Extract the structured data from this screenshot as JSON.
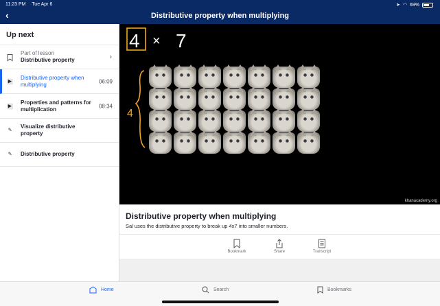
{
  "status": {
    "time": "11:23 PM",
    "date": "Tue Apr 6",
    "battery": "69%",
    "battery_level": 0.69
  },
  "header": {
    "title": "Distributive property when multiplying"
  },
  "sidebar": {
    "heading": "Up next",
    "items": [
      {
        "sub": "Part of lesson",
        "label": "Distributive property",
        "type": "bookmark"
      },
      {
        "label": "Distributive property when multiplying",
        "duration": "06:09",
        "type": "video",
        "active": true
      },
      {
        "label": "Properties and patterns for multiplication",
        "duration": "08:34",
        "type": "video"
      },
      {
        "label": "Visualize distributive property",
        "type": "exercise"
      },
      {
        "label": "Distributive property",
        "type": "exercise"
      }
    ]
  },
  "video": {
    "handwriting": {
      "rows": "4",
      "times": "×",
      "cols": "7",
      "side": "4"
    },
    "watermark": "khanacademy.org"
  },
  "info": {
    "title": "Distributive property when multiplying",
    "description": "Sal uses the distributive property to break up 4x7 into smaller numbers."
  },
  "actions": {
    "bookmark": "Bookmark",
    "share": "Share",
    "transcript": "Transcript"
  },
  "tabs": {
    "home": "Home",
    "search": "Search",
    "bookmarks": "Bookmarks"
  },
  "colors": {
    "header": "#0a2a66",
    "accent": "#1865f2",
    "handwriting": "#f5a623"
  }
}
